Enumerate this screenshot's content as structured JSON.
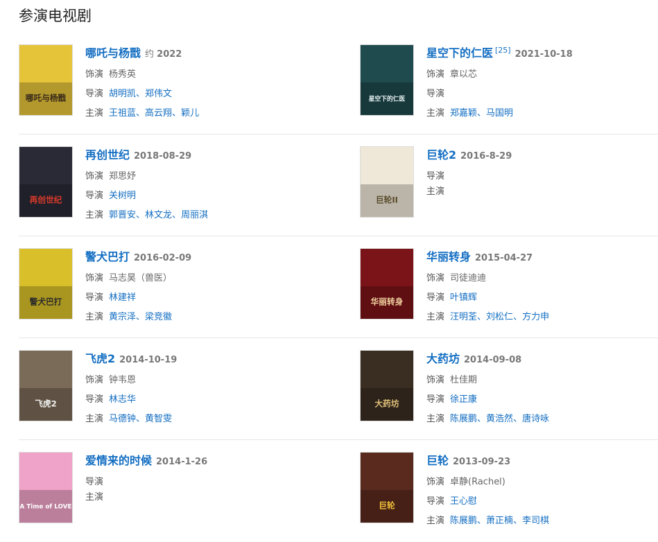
{
  "section_title": "参演电视剧",
  "labels": {
    "role": "饰演",
    "director": "导演",
    "cast": "主演",
    "sep": "、"
  },
  "items": [
    {
      "title": "哪吒与杨戬",
      "year_prefix": "约",
      "date": "2022",
      "role": "杨秀英",
      "directors": [
        "胡明凯",
        "郑伟文"
      ],
      "cast": [
        "王祖蓝",
        "高云翔",
        "颖儿"
      ]
    },
    {
      "title": "星空下的仁医",
      "sup": "[25]",
      "date": "2021-10-18",
      "role": "章以芯",
      "directors": [],
      "cast": [
        "郑嘉颖",
        "马国明"
      ]
    },
    {
      "title": "再创世纪",
      "date": "2018-08-29",
      "role": "郑思妤",
      "directors": [
        "关树明"
      ],
      "cast": [
        "郭晋安",
        "林文龙",
        "周丽淇"
      ]
    },
    {
      "title": "巨轮2",
      "date": "2016-8-29",
      "directors": [],
      "cast": []
    },
    {
      "title": "警犬巴打",
      "date": "2016-02-09",
      "role": "马志昊（兽医）",
      "directors": [
        "林建祥"
      ],
      "cast": [
        "黄宗泽",
        "梁竞徽"
      ]
    },
    {
      "title": "华丽转身",
      "date": "2015-04-27",
      "role": "司徒迪迪",
      "directors": [
        "叶镇辉"
      ],
      "cast": [
        "汪明荃",
        "刘松仁",
        "方力申"
      ]
    },
    {
      "title": "飞虎2",
      "date": "2014-10-19",
      "role": "钟韦恩",
      "directors": [
        "林志华"
      ],
      "cast": [
        "马德钟",
        "黄智雯"
      ]
    },
    {
      "title": "大药坊",
      "date": "2014-09-08",
      "role": "杜佳期",
      "directors": [
        "徐正康"
      ],
      "cast": [
        "陈展鹏",
        "黄浩然",
        "唐诗咏"
      ]
    },
    {
      "title": "爱情来的时候",
      "date": "2014-1-26",
      "directors": [],
      "cast": []
    },
    {
      "title": "巨轮",
      "date": "2013-09-23",
      "role": "卓静(Rachel)",
      "directors": [
        "王心慰"
      ],
      "cast": [
        "陈展鹏",
        "萧正楠",
        "李司棋"
      ]
    }
  ],
  "posters": [
    {
      "text": "哪吒与杨戬",
      "bg": "#e6c43a",
      "fg": "#3a2a1a"
    },
    {
      "text": "星空下的仁医",
      "bg": "#1f4a4e",
      "fg": "#e8f2f2"
    },
    {
      "text": "再创世纪",
      "bg": "#2a2a36",
      "fg": "#d83a2a"
    },
    {
      "text": "巨轮II",
      "bg": "#efe8d8",
      "fg": "#5a4a2a"
    },
    {
      "text": "警犬巴打",
      "bg": "#d9c02a",
      "fg": "#2a2a2a"
    },
    {
      "text": "华丽转身",
      "bg": "#7a1418",
      "fg": "#f2d2a0"
    },
    {
      "text": "飞虎2",
      "bg": "#7a6a58",
      "fg": "#f0f0f0"
    },
    {
      "text": "大药坊",
      "bg": "#3a2e22",
      "fg": "#e2c27a"
    },
    {
      "text": "A Time of LOVE",
      "bg": "#f0a3c8",
      "fg": "#ffffff"
    },
    {
      "text": "巨轮",
      "bg": "#5a2a1e",
      "fg": "#f2c23a"
    }
  ]
}
